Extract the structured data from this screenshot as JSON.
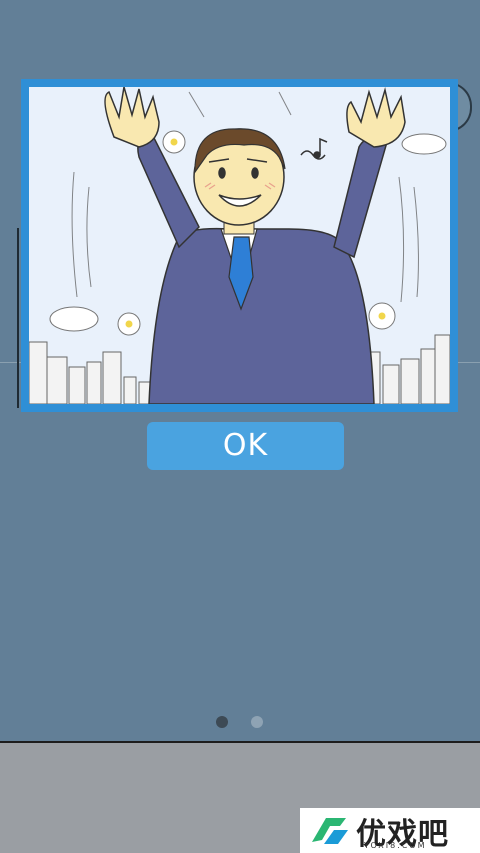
{
  "dialog": {
    "ok_label": "OK"
  },
  "pager": {
    "page_count": 2,
    "current_page": 1
  },
  "watermark": {
    "name": "优戏吧",
    "url": "YOXI8.COM",
    "icon": "yoxi8-logo-icon"
  },
  "illustration": {
    "icon": "cheering-businessman-illustration"
  },
  "colors": {
    "frame": "#2f8fd6",
    "button": "#4aa3e0",
    "background": "#627f97",
    "suit": "#5d649a",
    "tie": "#2e7fd6"
  }
}
